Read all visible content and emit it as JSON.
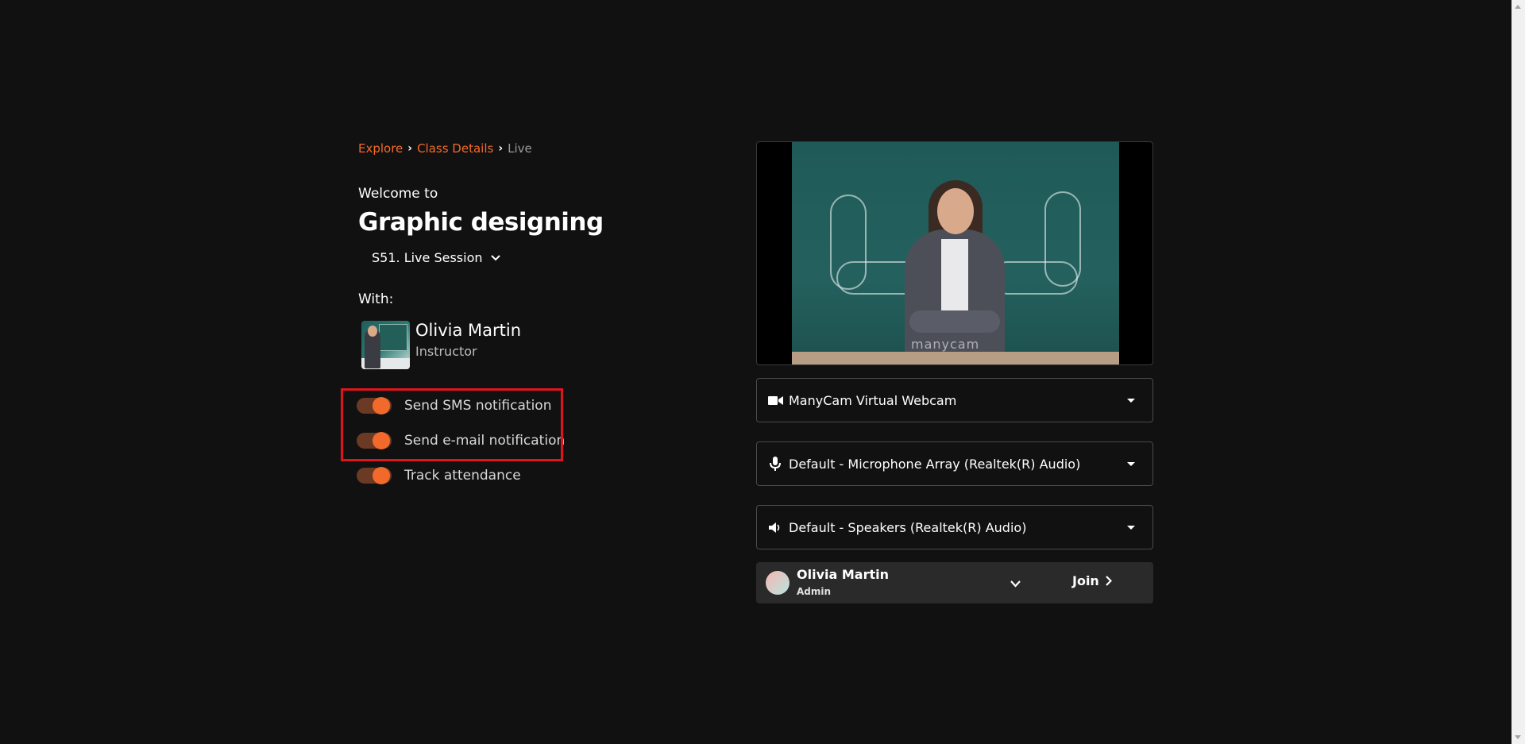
{
  "breadcrumb": {
    "items": [
      "Explore",
      "Class Details"
    ],
    "current": "Live"
  },
  "welcome_text": "Welcome to",
  "course_title": "Graphic designing",
  "session": {
    "selected": "S51. Live Session"
  },
  "with_label": "With:",
  "instructor": {
    "name": "Olivia Martin",
    "role": "Instructor"
  },
  "toggles": {
    "sms": {
      "label": "Send SMS notification",
      "on": true
    },
    "email": {
      "label": "Send e-mail notification",
      "on": true
    },
    "attendance": {
      "label": "Track attendance",
      "on": true
    }
  },
  "video": {
    "watermark": "manycam"
  },
  "devices": {
    "camera": {
      "value": "ManyCam Virtual Webcam",
      "icon": "video-camera-icon"
    },
    "microphone": {
      "value": "Default - Microphone Array (Realtek(R) Audio)",
      "icon": "microphone-icon"
    },
    "speaker": {
      "value": "Default - Speakers (Realtek(R) Audio)",
      "icon": "speaker-icon"
    }
  },
  "user": {
    "name": "Olivia Martin",
    "role": "Admin"
  },
  "join_label": "Join",
  "colors": {
    "accent": "#f26a2b",
    "background": "#111111",
    "highlight": "#e0141e"
  }
}
